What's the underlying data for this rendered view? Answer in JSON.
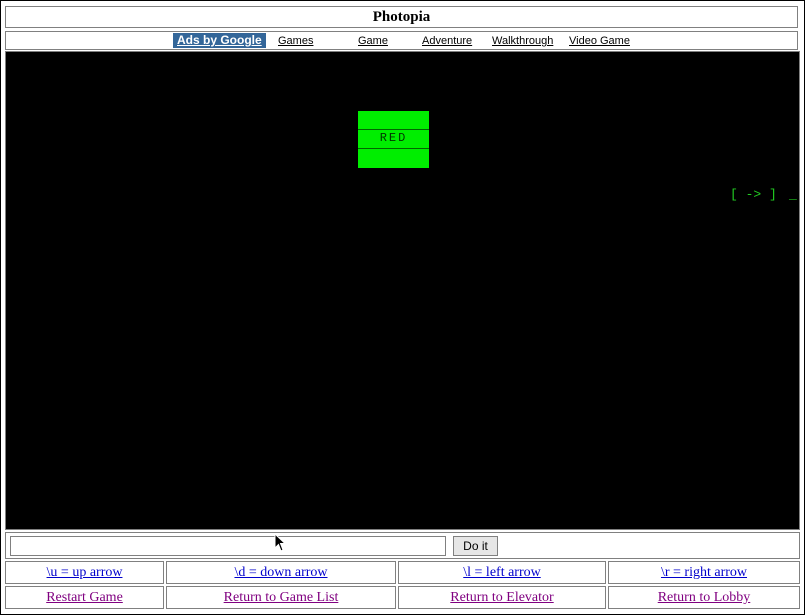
{
  "title": "Photopia",
  "nav": {
    "ads_label": "Ads by Google",
    "links": [
      "Games",
      "Game",
      "Adventure",
      "Walkthrough",
      "Video Game"
    ]
  },
  "game_screen": {
    "box_word": "RED",
    "box_color": "#00ee00",
    "arrow_hint": "[ -> ]",
    "cursor": "_"
  },
  "command": {
    "input_value": "",
    "button_label": "Do it"
  },
  "key_help": [
    "\\u = up arrow",
    "\\d = down arrow",
    "\\l = left arrow",
    "\\r = right arrow"
  ],
  "nav_links": [
    "Restart Game",
    "Return to Game List",
    "Return to Elevator",
    "Return to Lobby"
  ]
}
